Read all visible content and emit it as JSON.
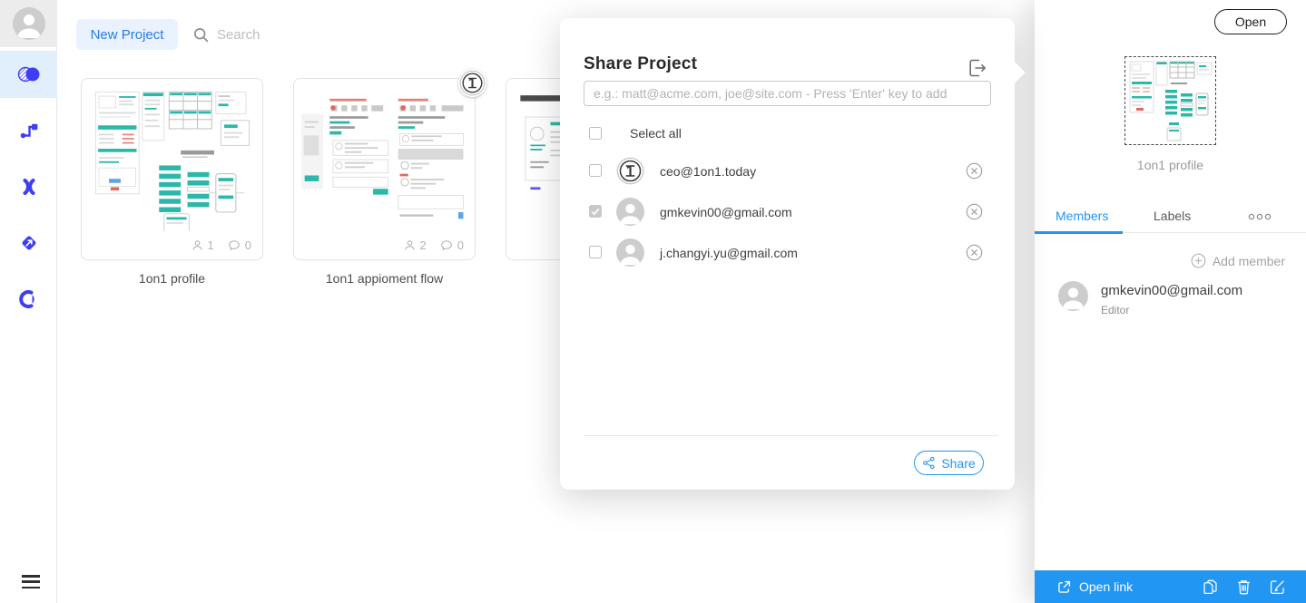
{
  "colors": {
    "accent_blue": "#2196f3",
    "sidebar_indigo": "#3e3ef2",
    "teal": "#2bb8a8",
    "new_project_blue": "#2a7ce0",
    "new_project_bg": "#e9f2fe"
  },
  "sidebar": {
    "icons": [
      "user-avatar",
      "overlapping-circles-icon",
      "flow-nodes-icon",
      "curly-transitions-icon",
      "send-diamond-icon",
      "pie-chart-icon",
      "hamburger-menu-icon"
    ]
  },
  "header": {
    "new_project_label": "New Project",
    "search_placeholder": "Search"
  },
  "projects": [
    {
      "name": "1on1 profile",
      "members_count": "1",
      "comments_count": "0"
    },
    {
      "name": "1on1 appioment flow",
      "members_count": "2",
      "comments_count": "0",
      "badge_icon": "1on1-logo"
    },
    {
      "name": ""
    }
  ],
  "share_modal": {
    "title": "Share Project",
    "input_placeholder": "e.g.: matt@acme.com, joe@site.com - Press 'Enter' key to add",
    "select_all_label": "Select all",
    "users": [
      {
        "email": "ceo@1on1.today",
        "checked": false,
        "avatar": "1on1-logo"
      },
      {
        "email": "gmkevin00@gmail.com",
        "checked": true,
        "avatar": "generic"
      },
      {
        "email": "j.changyi.yu@gmail.com",
        "checked": false,
        "avatar": "generic"
      }
    ],
    "share_label": "Share"
  },
  "right_panel": {
    "open_label": "Open",
    "project_name": "1on1 profile",
    "tabs": [
      {
        "label": "Members",
        "active": true
      },
      {
        "label": "Labels",
        "active": false
      }
    ],
    "add_member_label": "Add member",
    "members": [
      {
        "email": "gmkevin00@gmail.com",
        "role": "Editor"
      }
    ],
    "footer": {
      "open_link_label": "Open link"
    }
  }
}
